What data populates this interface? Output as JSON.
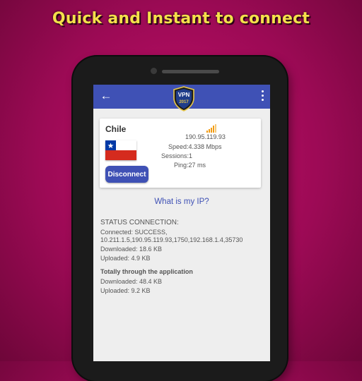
{
  "headline": "Quick and Instant  to connect",
  "app_bar": {
    "logo_top": "VPN",
    "logo_bottom": "2017"
  },
  "server_card": {
    "country": "Chile",
    "ip": "190.95.119.93",
    "speed": "Speed:4.338 Mbps",
    "sessions": "Sessions:1",
    "ping": "Ping:27 ms",
    "disconnect_label": "Disconnect"
  },
  "what_is_my_ip": "What is my IP?",
  "status": {
    "heading": "STATUS CONNECTION:",
    "connected_line1": "Connected: SUCCESS,",
    "connected_line2": "10.211.1.5,190.95.119.93,1750,192.168.1.4,35730",
    "downloaded": "Downloaded: 18.6 KB",
    "uploaded": "Uploaded: 4.9 KB",
    "total_heading": "Totally through the application",
    "total_downloaded": "Downloaded: 48.4 KB",
    "total_uploaded": "Uploaded: 9.2 KB"
  },
  "colors": {
    "background": "#b00d62",
    "headline": "#f4e04a",
    "app_bar": "#3f51b5",
    "signal": "#f39c12"
  },
  "icons": [
    "back-arrow-icon",
    "vpn-shield-logo",
    "overflow-menu-icon",
    "chile-flag-icon",
    "signal-strength-icon"
  ]
}
